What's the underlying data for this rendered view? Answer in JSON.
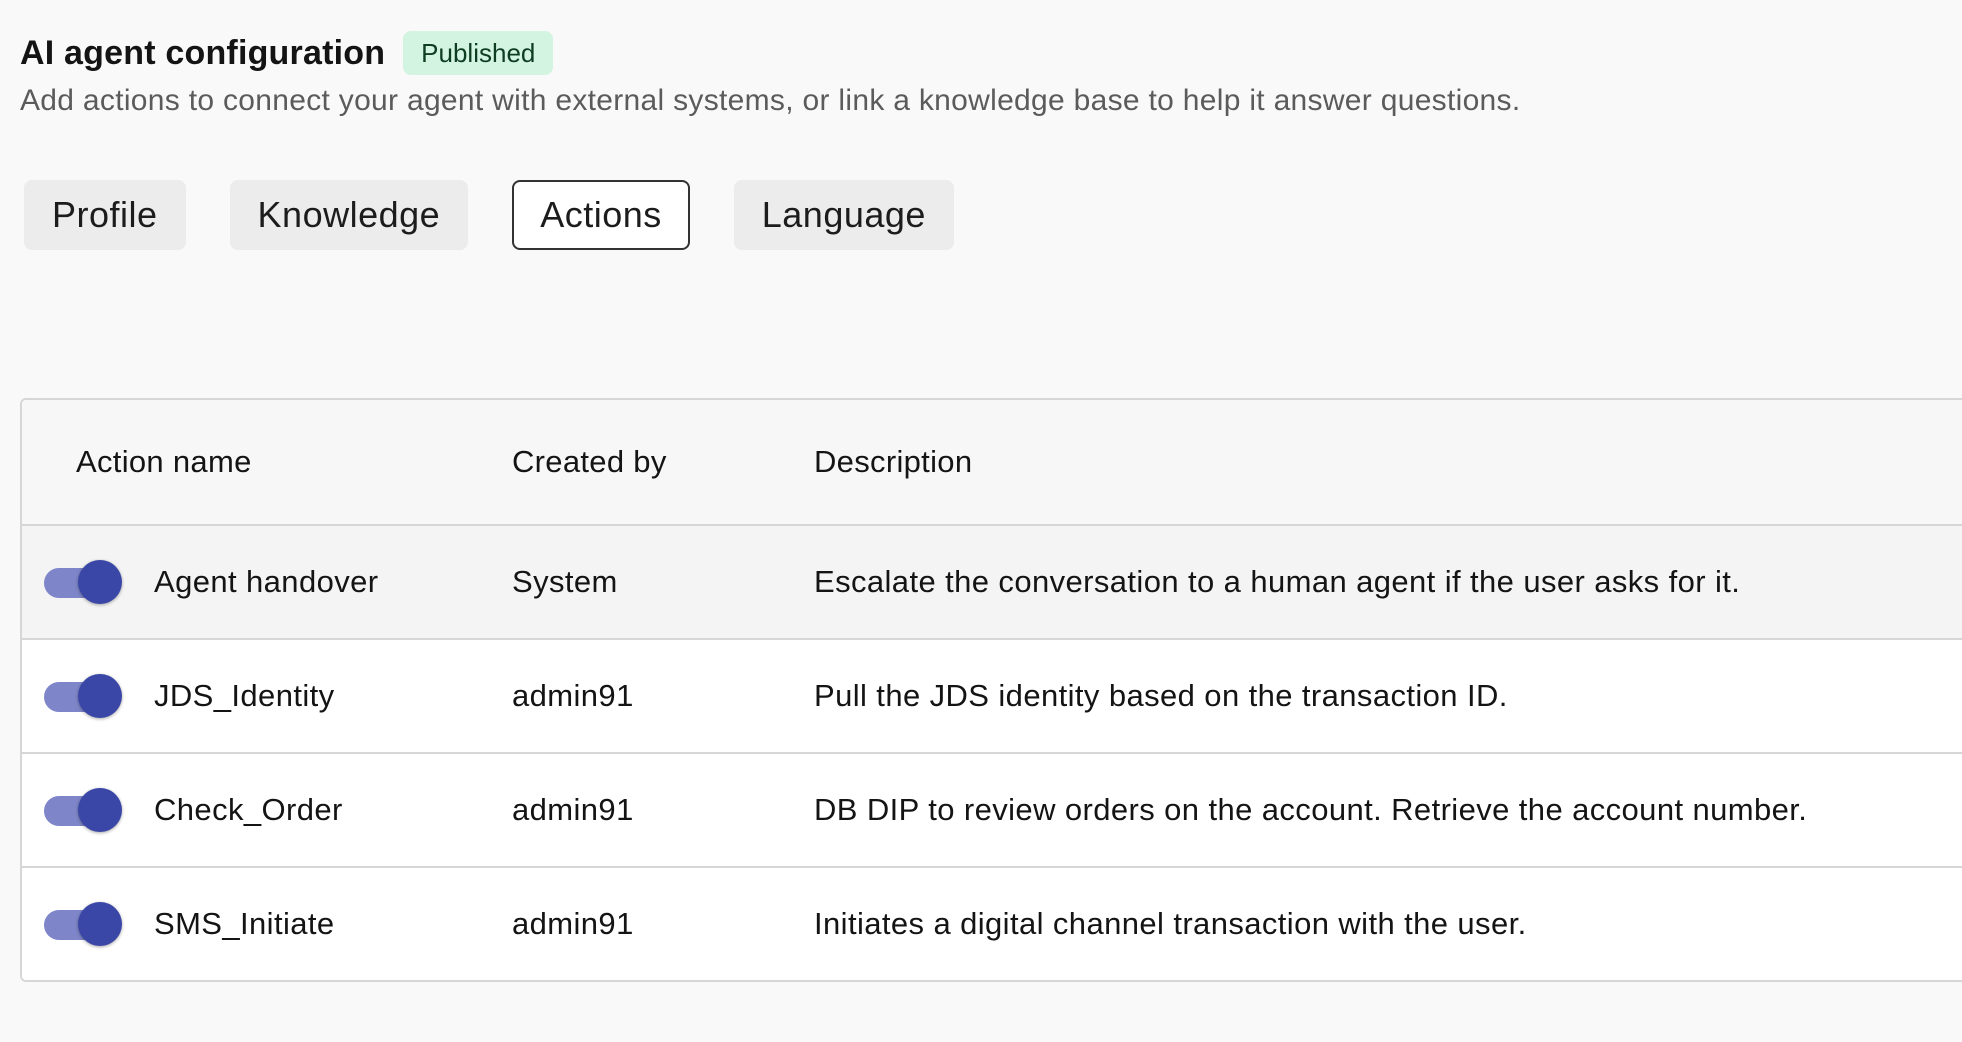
{
  "header": {
    "title": "AI agent configuration",
    "status_badge": "Published",
    "subtitle": "Add actions to connect your agent with external systems, or link a knowledge base to help it answer questions."
  },
  "tabs": [
    {
      "label": "Profile",
      "active": false
    },
    {
      "label": "Knowledge",
      "active": false
    },
    {
      "label": "Actions",
      "active": true
    },
    {
      "label": "Language",
      "active": false
    }
  ],
  "table": {
    "columns": {
      "action_name": "Action name",
      "created_by": "Created by",
      "description": "Description"
    },
    "rows": [
      {
        "enabled": true,
        "name": "Agent handover",
        "created_by": "System",
        "description": "Escalate the conversation to a human agent if the user asks for it."
      },
      {
        "enabled": true,
        "name": "JDS_Identity",
        "created_by": "admin91",
        "description": "Pull the JDS identity based on the transaction ID."
      },
      {
        "enabled": true,
        "name": "Check_Order",
        "created_by": "admin91",
        "description": "DB DIP to review orders on the account. Retrieve the account number."
      },
      {
        "enabled": true,
        "name": "SMS_Initiate",
        "created_by": "admin91",
        "description": "Initiates a digital channel transaction with the user."
      }
    ]
  },
  "colors": {
    "badge_bg": "#d3f4e0",
    "toggle_track": "#7e86c9",
    "toggle_knob": "#3a47a6"
  }
}
